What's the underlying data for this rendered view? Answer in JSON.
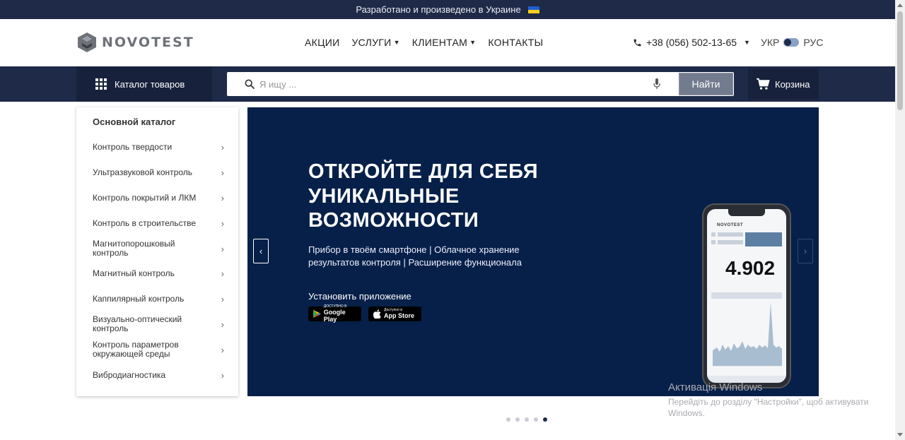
{
  "topbar": {
    "text": "Разработано и произведено в Украине",
    "flag_icon": "ukraine-flag-icon"
  },
  "header": {
    "logo_text": "NOVOTEST",
    "nav": [
      {
        "label": "АКЦИИ",
        "has_dropdown": false
      },
      {
        "label": "УСЛУГИ",
        "has_dropdown": true
      },
      {
        "label": "КЛИЕНТАМ",
        "has_dropdown": true
      },
      {
        "label": "КОНТАКТЫ",
        "has_dropdown": false
      }
    ],
    "phone": "+38 (056) 502-13-65",
    "lang_ukr": "УКР",
    "lang_rus": "РУС"
  },
  "toolbar": {
    "catalog_label": "Каталог товаров",
    "search_placeholder": "Я ищу ...",
    "find_label": "Найти",
    "cart_label": "Корзина"
  },
  "sidebar": {
    "title": "Основной каталог",
    "items": [
      {
        "label": "Контроль твердости"
      },
      {
        "label": "Ультразвуковой контроль"
      },
      {
        "label": "Контроль покрытий и ЛКМ"
      },
      {
        "label": "Контроль в строительстве"
      },
      {
        "label": "Магнитопорошковый контроль"
      },
      {
        "label": "Магнитный контроль"
      },
      {
        "label": "Каппилярный контроль"
      },
      {
        "label": "Визуально-оптический контроль"
      },
      {
        "label": "Контроль параметров окружающей среды"
      },
      {
        "label": "Вибродиагностика"
      }
    ]
  },
  "banner": {
    "headline_lines": [
      "ОТКРОЙТЕ ДЛЯ СЕБЯ",
      "УНИКАЛЬНЫЕ",
      "ВОЗМОЖНОСТИ"
    ],
    "subtitle": "Прибор в твоём смартфоне | Облачное хранение результатов контроля | Расширение функционала",
    "install_label": "Установить приложение",
    "google_play_small": "ДОСТУПНО В",
    "google_play_label": "Google Play",
    "app_store_small": "Доступно в",
    "app_store_label": "App Store",
    "phone_logo": "NOVOTEST",
    "phone_value": "4.902",
    "background_color": "#062049"
  },
  "slider": {
    "total_slides": 5,
    "active_slide": 5
  },
  "watermark": {
    "title": "Активація Windows",
    "subtitle": "Перейдіть до розділу \"Настройки\", щоб активувати Windows."
  },
  "colors": {
    "dark_navy": "#1f2a48",
    "button_gray": "#737b8f"
  }
}
